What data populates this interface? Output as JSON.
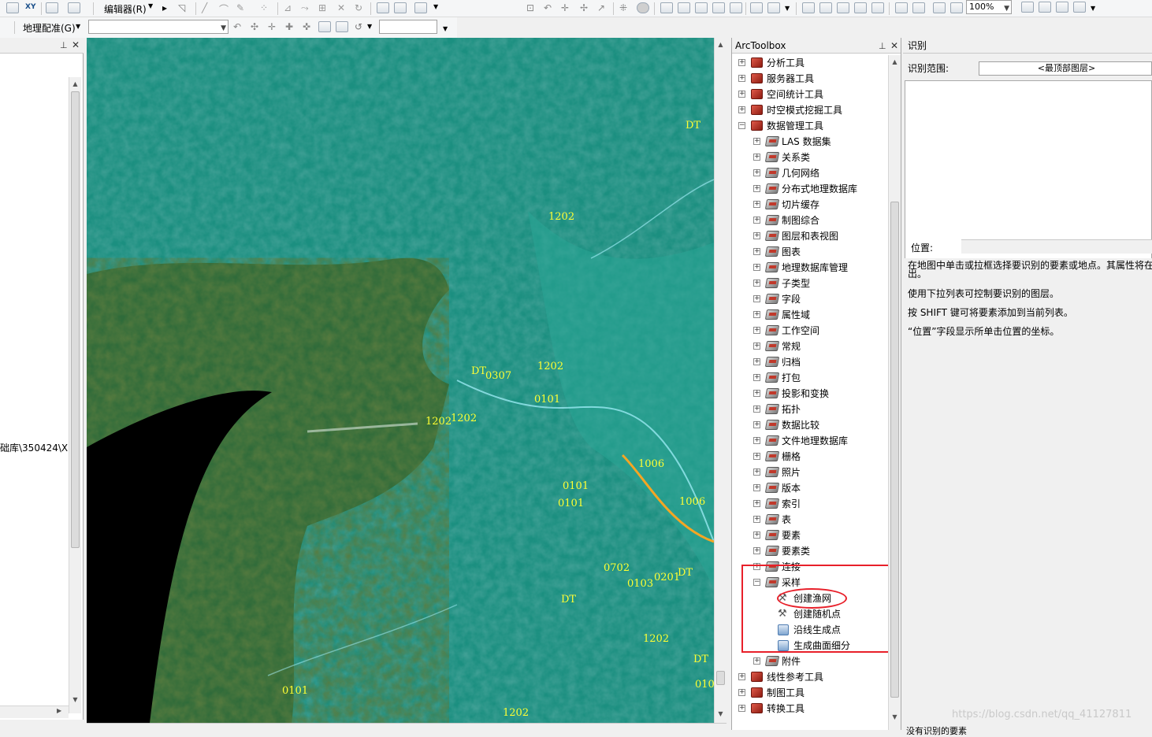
{
  "toolbar": {
    "xy_label": "XY",
    "editor_label": "编辑器(R)",
    "georef_label": "地理配准(G)",
    "zoom_value": "100%"
  },
  "left_panel": {
    "path_text": "础库\\350424\\X"
  },
  "map": {
    "labels": [
      "DT",
      "1202",
      "DT",
      "0307",
      "1202",
      "0101",
      "1202",
      "1202",
      "1006",
      "0101",
      "1006",
      "0101",
      "0702",
      "0103",
      "0201",
      "DT",
      "DT",
      "1202",
      "DT",
      "0101",
      "010",
      "1202"
    ]
  },
  "toolbox": {
    "title": "ArcToolbox",
    "items": [
      {
        "label": "分析工具",
        "level": 0,
        "expanded": false,
        "icon": "toolbox-icon"
      },
      {
        "label": "服务器工具",
        "level": 0,
        "expanded": false,
        "icon": "toolbox-icon"
      },
      {
        "label": "空间统计工具",
        "level": 0,
        "expanded": false,
        "icon": "toolbox-icon"
      },
      {
        "label": "时空模式挖掘工具",
        "level": 0,
        "expanded": false,
        "icon": "toolbox-icon"
      },
      {
        "label": "数据管理工具",
        "level": 0,
        "expanded": true,
        "icon": "toolbox-icon"
      },
      {
        "label": "LAS 数据集",
        "level": 1,
        "expanded": false,
        "icon": "toolset-icon"
      },
      {
        "label": "关系类",
        "level": 1,
        "expanded": false,
        "icon": "toolset-icon"
      },
      {
        "label": "几何网络",
        "level": 1,
        "expanded": false,
        "icon": "toolset-icon"
      },
      {
        "label": "分布式地理数据库",
        "level": 1,
        "expanded": false,
        "icon": "toolset-icon"
      },
      {
        "label": "切片缓存",
        "level": 1,
        "expanded": false,
        "icon": "toolset-icon"
      },
      {
        "label": "制图综合",
        "level": 1,
        "expanded": false,
        "icon": "toolset-icon"
      },
      {
        "label": "图层和表视图",
        "level": 1,
        "expanded": false,
        "icon": "toolset-icon"
      },
      {
        "label": "图表",
        "level": 1,
        "expanded": false,
        "icon": "toolset-icon"
      },
      {
        "label": "地理数据库管理",
        "level": 1,
        "expanded": false,
        "icon": "toolset-icon"
      },
      {
        "label": "子类型",
        "level": 1,
        "expanded": false,
        "icon": "toolset-icon"
      },
      {
        "label": "字段",
        "level": 1,
        "expanded": false,
        "icon": "toolset-icon"
      },
      {
        "label": "属性域",
        "level": 1,
        "expanded": false,
        "icon": "toolset-icon"
      },
      {
        "label": "工作空间",
        "level": 1,
        "expanded": false,
        "icon": "toolset-icon"
      },
      {
        "label": "常规",
        "level": 1,
        "expanded": false,
        "icon": "toolset-icon"
      },
      {
        "label": "归档",
        "level": 1,
        "expanded": false,
        "icon": "toolset-icon"
      },
      {
        "label": "打包",
        "level": 1,
        "expanded": false,
        "icon": "toolset-icon"
      },
      {
        "label": "投影和变换",
        "level": 1,
        "expanded": false,
        "icon": "toolset-icon"
      },
      {
        "label": "拓扑",
        "level": 1,
        "expanded": false,
        "icon": "toolset-icon"
      },
      {
        "label": "数据比较",
        "level": 1,
        "expanded": false,
        "icon": "toolset-icon"
      },
      {
        "label": "文件地理数据库",
        "level": 1,
        "expanded": false,
        "icon": "toolset-icon"
      },
      {
        "label": "栅格",
        "level": 1,
        "expanded": false,
        "icon": "toolset-icon"
      },
      {
        "label": "照片",
        "level": 1,
        "expanded": false,
        "icon": "toolset-icon"
      },
      {
        "label": "版本",
        "level": 1,
        "expanded": false,
        "icon": "toolset-icon"
      },
      {
        "label": "索引",
        "level": 1,
        "expanded": false,
        "icon": "toolset-icon"
      },
      {
        "label": "表",
        "level": 1,
        "expanded": false,
        "icon": "toolset-icon"
      },
      {
        "label": "要素",
        "level": 1,
        "expanded": false,
        "icon": "toolset-icon"
      },
      {
        "label": "要素类",
        "level": 1,
        "expanded": false,
        "icon": "toolset-icon"
      },
      {
        "label": "连接",
        "level": 1,
        "expanded": false,
        "icon": "toolset-icon"
      },
      {
        "label": "采样",
        "level": 1,
        "expanded": true,
        "icon": "toolset-icon"
      },
      {
        "label": "创建渔网",
        "level": 2,
        "icon": "hammer-icon"
      },
      {
        "label": "创建随机点",
        "level": 2,
        "icon": "hammer-icon"
      },
      {
        "label": "沿线生成点",
        "level": 2,
        "icon": "script-icon"
      },
      {
        "label": "生成曲面细分",
        "level": 2,
        "icon": "script-icon"
      },
      {
        "label": "附件",
        "level": 1,
        "expanded": false,
        "icon": "toolset-icon"
      },
      {
        "label": "线性参考工具",
        "level": 0,
        "expanded": false,
        "icon": "toolbox-icon"
      },
      {
        "label": "制图工具",
        "level": 0,
        "expanded": false,
        "icon": "toolbox-icon"
      },
      {
        "label": "转换工具",
        "level": 0,
        "expanded": false,
        "icon": "toolbox-icon"
      }
    ]
  },
  "identify": {
    "title": "识别",
    "scope_label": "识别范围:",
    "scope_value": "<最顶部图层>",
    "location_label": "位置:",
    "desc_lines": [
      "在地图中单击或拉框选择要识别的要素或地点。其属性将在",
      "出。",
      "使用下拉列表可控制要识别的图层。",
      "按 SHIFT 键可将要素添加到当前列表。",
      "“位置”字段显示所单击位置的坐标。"
    ],
    "status_text": "没有识别的要素",
    "watermark": "https://blog.csdn.net/qq_41127811"
  },
  "colors": {
    "highlight_rect": "#e8202a",
    "map_label": "#ffff33",
    "map_feature": "#f5a623"
  }
}
